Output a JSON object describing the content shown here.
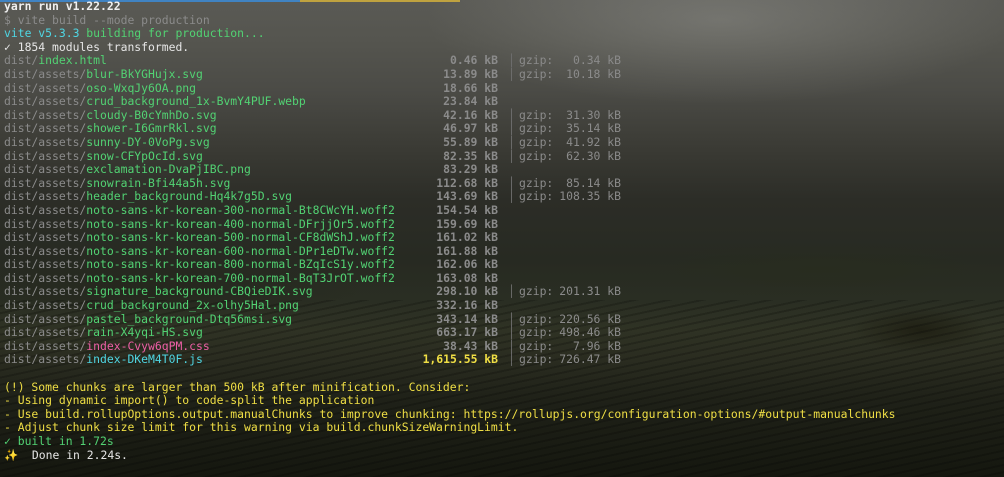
{
  "header": {
    "yarn_run": "yarn run v1.22.22",
    "command": "$ vite build --mode production",
    "vite_version": "vite v5.3.3",
    "building": "building for production...",
    "modules": "✓ 1854 modules transformed."
  },
  "files": [
    {
      "dir": "dist/",
      "name": "index.html",
      "kind": "html",
      "size": "0.46 kB",
      "gzip": "0.34 kB"
    },
    {
      "dir": "dist/assets/",
      "name": "blur-BkYGHujx.svg",
      "kind": "asset",
      "size": "13.89 kB",
      "gzip": "10.18 kB"
    },
    {
      "dir": "dist/assets/",
      "name": "oso-WxqJy6OA.png",
      "kind": "asset",
      "size": "18.66 kB",
      "gzip": ""
    },
    {
      "dir": "dist/assets/",
      "name": "crud_background_1x-BvmY4PUF.webp",
      "kind": "asset",
      "size": "23.84 kB",
      "gzip": ""
    },
    {
      "dir": "dist/assets/",
      "name": "cloudy-B0cYmhDo.svg",
      "kind": "asset",
      "size": "42.16 kB",
      "gzip": "31.30 kB"
    },
    {
      "dir": "dist/assets/",
      "name": "shower-I6GmrRkl.svg",
      "kind": "asset",
      "size": "46.97 kB",
      "gzip": "35.14 kB"
    },
    {
      "dir": "dist/assets/",
      "name": "sunny-DY-0VoPg.svg",
      "kind": "asset",
      "size": "55.89 kB",
      "gzip": "41.92 kB"
    },
    {
      "dir": "dist/assets/",
      "name": "snow-CFYpOcId.svg",
      "kind": "asset",
      "size": "82.35 kB",
      "gzip": "62.30 kB"
    },
    {
      "dir": "dist/assets/",
      "name": "exclamation-DvaPjIBC.png",
      "kind": "asset",
      "size": "83.29 kB",
      "gzip": ""
    },
    {
      "dir": "dist/assets/",
      "name": "snowrain-Bfi44a5h.svg",
      "kind": "asset",
      "size": "112.68 kB",
      "gzip": "85.14 kB"
    },
    {
      "dir": "dist/assets/",
      "name": "header_background-Hq4k7g5D.svg",
      "kind": "asset",
      "size": "143.69 kB",
      "gzip": "108.35 kB"
    },
    {
      "dir": "dist/assets/",
      "name": "noto-sans-kr-korean-300-normal-Bt8CWcYH.woff2",
      "kind": "asset",
      "size": "154.54 kB",
      "gzip": ""
    },
    {
      "dir": "dist/assets/",
      "name": "noto-sans-kr-korean-400-normal-DFrjjOr5.woff2",
      "kind": "asset",
      "size": "159.69 kB",
      "gzip": ""
    },
    {
      "dir": "dist/assets/",
      "name": "noto-sans-kr-korean-500-normal-CF8dWShJ.woff2",
      "kind": "asset",
      "size": "161.02 kB",
      "gzip": ""
    },
    {
      "dir": "dist/assets/",
      "name": "noto-sans-kr-korean-600-normal-DPr1eDTw.woff2",
      "kind": "asset",
      "size": "161.88 kB",
      "gzip": ""
    },
    {
      "dir": "dist/assets/",
      "name": "noto-sans-kr-korean-800-normal-BZqIcS1y.woff2",
      "kind": "asset",
      "size": "162.06 kB",
      "gzip": ""
    },
    {
      "dir": "dist/assets/",
      "name": "noto-sans-kr-korean-700-normal-BqT3JrOT.woff2",
      "kind": "asset",
      "size": "163.08 kB",
      "gzip": ""
    },
    {
      "dir": "dist/assets/",
      "name": "signature_background-CBQieDIK.svg",
      "kind": "asset",
      "size": "298.10 kB",
      "gzip": "201.31 kB"
    },
    {
      "dir": "dist/assets/",
      "name": "crud_background_2x-olhy5Hal.png",
      "kind": "asset",
      "size": "332.16 kB",
      "gzip": ""
    },
    {
      "dir": "dist/assets/",
      "name": "pastel_background-Dtq56msi.svg",
      "kind": "asset",
      "size": "343.14 kB",
      "gzip": "220.56 kB"
    },
    {
      "dir": "dist/assets/",
      "name": "rain-X4yqi-HS.svg",
      "kind": "asset",
      "size": "663.17 kB",
      "gzip": "498.46 kB"
    },
    {
      "dir": "dist/assets/",
      "name": "index-Cvyw6qPM.css",
      "kind": "css",
      "size": "38.43 kB",
      "gzip": "7.96 kB"
    },
    {
      "dir": "dist/assets/",
      "name": "index-DKeM4T0F.js",
      "kind": "js",
      "size": "1,615.55 kB",
      "gzip": "726.47 kB"
    }
  ],
  "gzip_label": "gzip:",
  "warning": {
    "title": "(!) Some chunks are larger than 500 kB after minification. Consider:",
    "lines": [
      "- Using dynamic import() to code-split the application",
      "- Use build.rollupOptions.output.manualChunks to improve chunking: https://rollupjs.org/configuration-options/#output-manualchunks",
      "- Adjust chunk size limit for this warning via build.chunkSizeWarningLimit."
    ]
  },
  "footer": {
    "built": "✓ built in 1.72s",
    "done_icon": "✨",
    "done": "  Done in 2.24s."
  },
  "colors": {
    "cyan": "#4fd6e3",
    "green": "#52d273",
    "pink": "#ee5fa6",
    "yellow": "#f0df45",
    "dim": "#8b8b8b"
  }
}
